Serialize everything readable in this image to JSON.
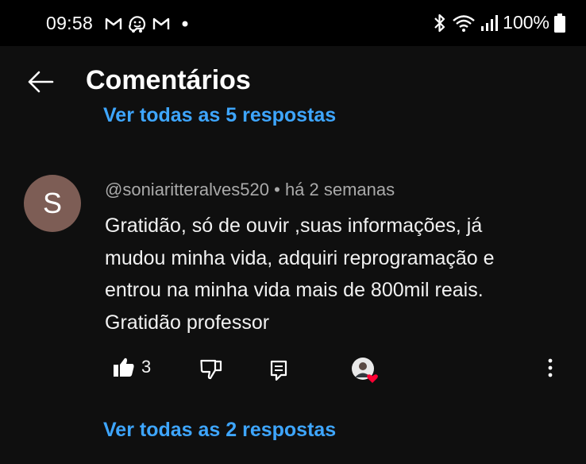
{
  "status_bar": {
    "time": "09:58",
    "battery": "100%",
    "notification_icons": [
      "gmail-icon",
      "waze-icon",
      "gmail-icon",
      "dot-icon"
    ],
    "system_icons": [
      "bluetooth-icon",
      "wifi-icon",
      "signal-icon",
      "battery-icon"
    ]
  },
  "header": {
    "title": "Comentários"
  },
  "previous_thread": {
    "view_replies": "Ver todas as 5 respostas"
  },
  "comment": {
    "avatar_letter": "S",
    "avatar_color": "#7d5d55",
    "author": "@soniaritteralves520",
    "separator": " • ",
    "time": "há 2 semanas",
    "lines": [
      "Gratidão,  só de ouvir ,suas informações,  já",
      "mudou minha vida, adquiri reprogramação e",
      "entrou na minha vida  mais de 800mil reais.",
      "Gratidão professor"
    ],
    "likes": "3",
    "view_replies": "Ver todas as 2 respostas"
  },
  "colors": {
    "background": "#0f0f0f",
    "link": "#3ea6ff",
    "meta": "#aaaaaa",
    "heart": "#ff0033"
  }
}
